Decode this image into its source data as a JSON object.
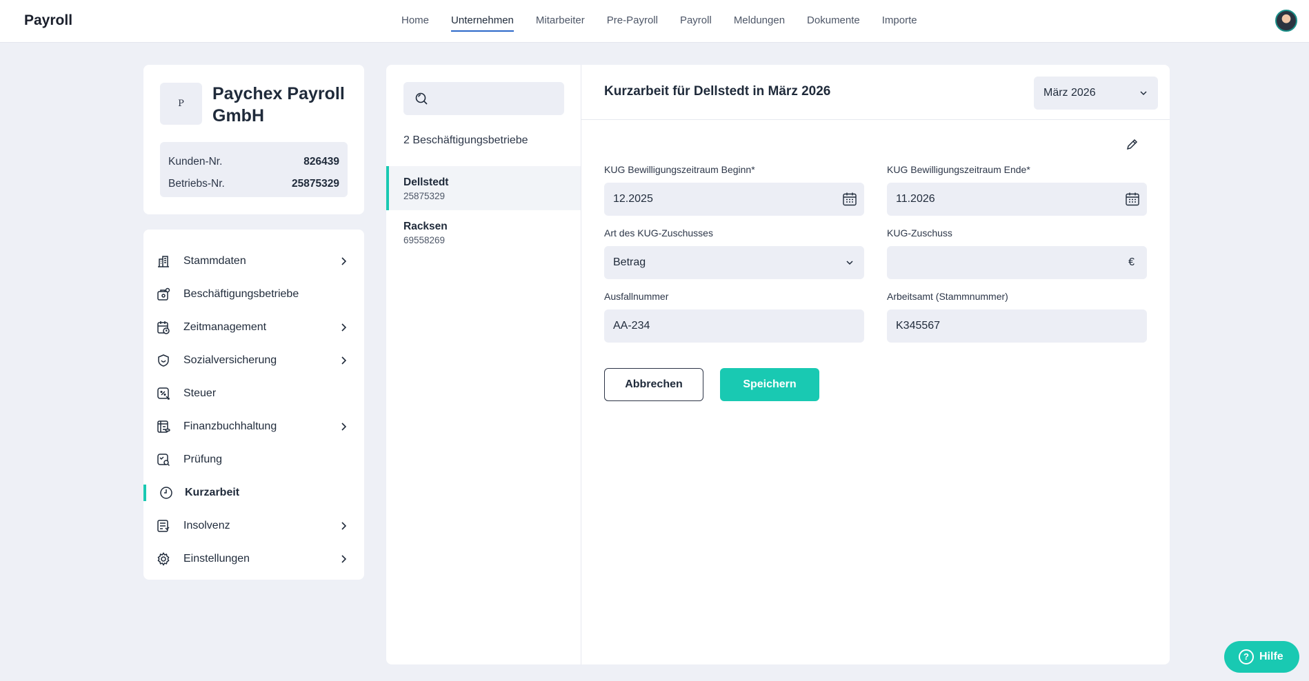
{
  "app": {
    "brand": "Payroll"
  },
  "nav": [
    {
      "label": "Home",
      "active": false
    },
    {
      "label": "Unternehmen",
      "active": true
    },
    {
      "label": "Mitarbeiter",
      "active": false
    },
    {
      "label": "Pre-Payroll",
      "active": false
    },
    {
      "label": "Payroll",
      "active": false
    },
    {
      "label": "Meldungen",
      "active": false
    },
    {
      "label": "Dokumente",
      "active": false
    },
    {
      "label": "Importe",
      "active": false
    }
  ],
  "company": {
    "logo_letter": "P",
    "name": "Paychex Payroll GmbH",
    "kunden_label": "Kunden-Nr.",
    "kunden_value": "826439",
    "betriebs_label": "Betriebs-Nr.",
    "betriebs_value": "25875329"
  },
  "sidebar": {
    "items": [
      {
        "label": "Stammdaten",
        "icon": "building-icon",
        "chevron": true,
        "active": false
      },
      {
        "label": "Beschäftigungsbetriebe",
        "icon": "briefcase-icon",
        "chevron": false,
        "active": false
      },
      {
        "label": "Zeitmanagement",
        "icon": "calendar-clock-icon",
        "chevron": true,
        "active": false
      },
      {
        "label": "Sozialversicherung",
        "icon": "shield-icon",
        "chevron": true,
        "active": false
      },
      {
        "label": "Steuer",
        "icon": "tax-icon",
        "chevron": false,
        "active": false
      },
      {
        "label": "Finanzbuchhaltung",
        "icon": "ledger-icon",
        "chevron": true,
        "active": false
      },
      {
        "label": "Prüfung",
        "icon": "audit-icon",
        "chevron": false,
        "active": false
      },
      {
        "label": "Kurzarbeit",
        "icon": "clock-icon",
        "chevron": false,
        "active": true
      },
      {
        "label": "Insolvenz",
        "icon": "document-list-icon",
        "chevron": true,
        "active": false
      },
      {
        "label": "Einstellungen",
        "icon": "gear-icon",
        "chevron": true,
        "active": false
      }
    ]
  },
  "list": {
    "search_placeholder": "",
    "count_label": "2 Beschäftigungsbetriebe",
    "items": [
      {
        "name": "Dellstedt",
        "number": "25875329",
        "active": true
      },
      {
        "name": "Racksen",
        "number": "69558269",
        "active": false
      }
    ]
  },
  "detail": {
    "title": "Kurzarbeit für Dellstedt in März 2026",
    "month_select": "März 2026",
    "fields": {
      "beginn_label": "KUG Bewilligungszeitraum Beginn*",
      "beginn_value": "12.2025",
      "ende_label": "KUG Bewilligungszeitraum Ende*",
      "ende_value": "11.2026",
      "art_label": "Art des KUG-Zuschusses",
      "art_value": "Betrag",
      "zuschuss_label": "KUG-Zuschuss",
      "zuschuss_value": "",
      "zuschuss_currency": "€",
      "ausfall_label": "Ausfallnummer",
      "ausfall_value": "AA-234",
      "arbeitsamt_label": "Arbeitsamt (Stammnummer)",
      "arbeitsamt_value": "K345567"
    },
    "buttons": {
      "cancel": "Abbrechen",
      "save": "Speichern"
    }
  },
  "help": {
    "label": "Hilfe",
    "glyph": "?"
  },
  "colors": {
    "accent": "#19c9b2",
    "nav_underline": "#2a67c8",
    "background": "#eef0f6",
    "field": "#eceef5"
  }
}
